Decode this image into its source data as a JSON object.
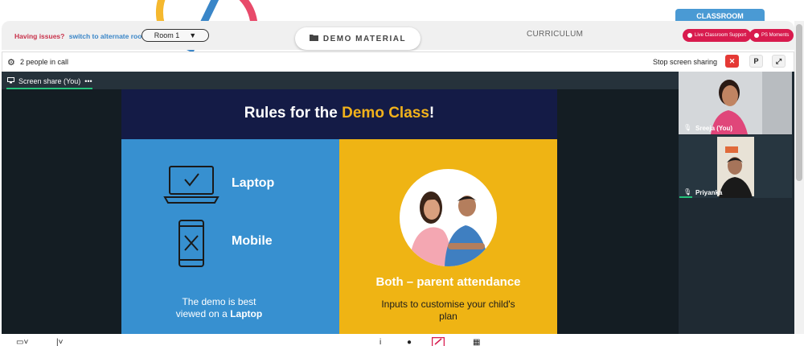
{
  "header": {
    "issues_text": "Having issues?",
    "alternate_room_link": "switch to alternate room",
    "room_select_value": "Room 1",
    "demo_material_label": "DEMO MATERIAL",
    "curriculum_label": "CURRICULUM",
    "classroom_tab": "CLASSROOM",
    "live_support_label": "Live Classroom Support",
    "ps_moments_label": "PS Moments"
  },
  "call": {
    "people_count_text": "2 people in call",
    "stop_sharing_label": "Stop screen sharing",
    "p_button_label": "P",
    "screen_share_tab": "Screen share (You)",
    "more_label": "•••"
  },
  "slide": {
    "title_prefix": "Rules for the ",
    "title_highlight": "Demo Class",
    "title_suffix": "!",
    "laptop_label": "Laptop",
    "mobile_label": "Mobile",
    "note_left_1": "The demo is best",
    "note_left_2": "viewed on a ",
    "note_left_bold": "Laptop",
    "both_label": "Both – parent attendance",
    "note_right": "Inputs to customise your child's plan"
  },
  "participants": [
    {
      "name": "Sreeja (You)"
    },
    {
      "name": "Priyanka"
    }
  ],
  "colors": {
    "accent_red": "#d81b4e",
    "classroom_blue": "#4a9ad4",
    "slide_navy": "#141b46",
    "slide_blue": "#3790d0",
    "slide_yellow": "#efb414",
    "highlight_yellow": "#f2b21b",
    "active_green": "#23c27a"
  }
}
